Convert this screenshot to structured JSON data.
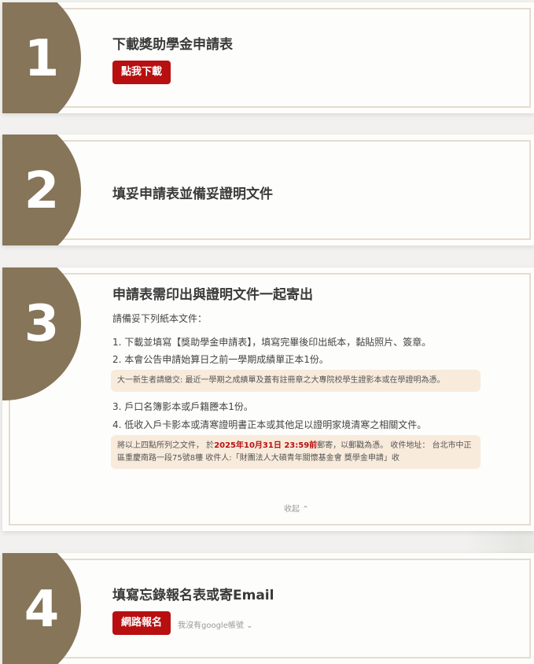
{
  "steps": [
    {
      "number": "1",
      "title": "下載獎助學金申請表",
      "button": "點我下載"
    },
    {
      "number": "2",
      "title": "填妥申請表並備妥證明文件"
    },
    {
      "number": "3",
      "title": "申請表需印出與證明文件一起寄出",
      "intro": "請備妥下列紙本文件：",
      "items": [
        "1. 下載並填寫【獎助學金申請表】，填寫完畢後印出紙本，黏貼照片、簽章。",
        "2. 本會公告申請始算日之前一學期成績單正本1份。"
      ],
      "note1": "大一新生者請繳交: 最近一學期之成績單及蓋有註冊章之大專院校學生證影本或在學證明為憑。",
      "items2": [
        "3. 戶口名簿影本或戶籍謄本1份。",
        "4. 低收入戶卡影本或清寒證明書正本或其他足以證明家境清寒之相關文件。"
      ],
      "note2_pre": "將以上四點所列之文件， 於",
      "note2_date": "2025年10月31日 23:59前",
      "note2_post": "郵寄，以郵戳為憑。 收件地址： 台北市中正區重慶南路一段75號8樓 收件人:「財團法人大碩青年關懷基金會 獎學金申請」收",
      "collapse": "收起"
    },
    {
      "number": "4",
      "title": "填寫忘錄報名表或寄Email",
      "button": "網路報名",
      "no_google": "我沒有google帳號"
    }
  ],
  "colors": {
    "accent": "#867558",
    "button": "#b80f10",
    "border": "#e6dccd",
    "note_bg": "#f8ebdc"
  }
}
